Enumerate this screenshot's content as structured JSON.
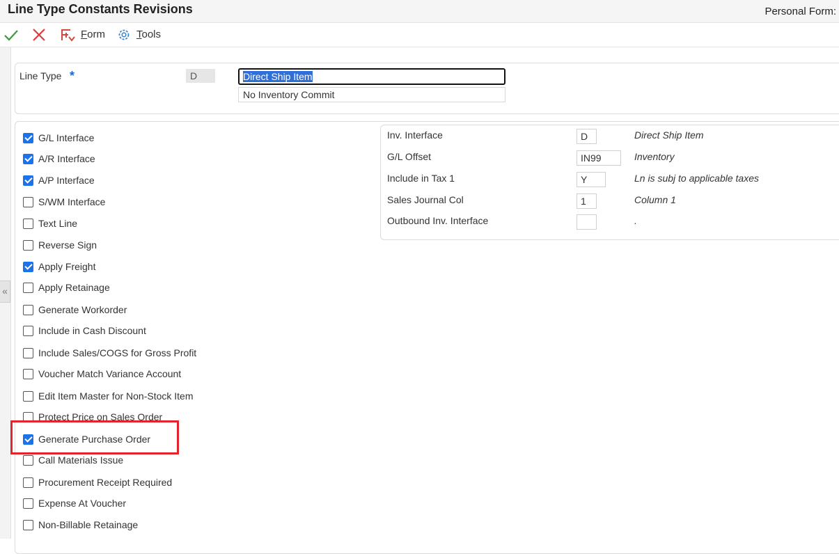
{
  "window": {
    "title": "Line Type Constants Revisions",
    "personal_form_label": "Personal Form:"
  },
  "toolbar": {
    "ok_icon": "check-icon",
    "cancel_icon": "close-icon",
    "form_icon": "form-icon",
    "form_label_underlined": "F",
    "form_label_rest": "orm",
    "tools_icon": "gear-icon",
    "tools_label_underlined": "T",
    "tools_label_rest": "ools"
  },
  "line_type": {
    "label": "Line Type",
    "required_marker": "*",
    "code": "D",
    "description": "Direct Ship Item",
    "description2": "No Inventory Commit"
  },
  "checkboxes": [
    {
      "label": "G/L Interface",
      "checked": true
    },
    {
      "label": "A/R Interface",
      "checked": true
    },
    {
      "label": "A/P Interface",
      "checked": true
    },
    {
      "label": "S/WM Interface",
      "checked": false
    },
    {
      "label": "Text Line",
      "checked": false
    },
    {
      "label": "Reverse Sign",
      "checked": false
    },
    {
      "label": "Apply Freight",
      "checked": true
    },
    {
      "label": "Apply Retainage",
      "checked": false
    },
    {
      "label": "Generate Workorder",
      "checked": false
    },
    {
      "label": "Include in Cash Discount",
      "checked": false
    },
    {
      "label": "Include Sales/COGS for Gross Profit",
      "checked": false
    },
    {
      "label": "Voucher Match Variance Account",
      "checked": false
    },
    {
      "label": "Edit Item Master for Non-Stock Item",
      "checked": false
    },
    {
      "label": "Protect Price on Sales Order",
      "checked": false
    },
    {
      "label": "Generate Purchase Order",
      "checked": true
    },
    {
      "label": "Call Materials Issue",
      "checked": false
    },
    {
      "label": "Procurement Receipt Required",
      "checked": false
    },
    {
      "label": "Expense At Voucher",
      "checked": false
    },
    {
      "label": "Non-Billable Retainage",
      "checked": false
    }
  ],
  "interface_fields": [
    {
      "label": "Inv. Interface",
      "value": "D",
      "description": "Direct Ship Item"
    },
    {
      "label": "G/L Offset",
      "value": "IN99",
      "description": "Inventory"
    },
    {
      "label": "Include in Tax 1",
      "value": "Y",
      "description": "Ln is subj to applicable taxes"
    },
    {
      "label": "Sales Journal Col",
      "value": "1",
      "description": "Column 1"
    },
    {
      "label": "Outbound Inv. Interface",
      "value": "",
      "description": "."
    }
  ],
  "sidebar": {
    "collapse_glyph": "«"
  },
  "colors": {
    "accent": "#1a73e8",
    "highlight": "#e3242b",
    "ok": "#3a9a3a",
    "cancel": "#e03a3a"
  }
}
